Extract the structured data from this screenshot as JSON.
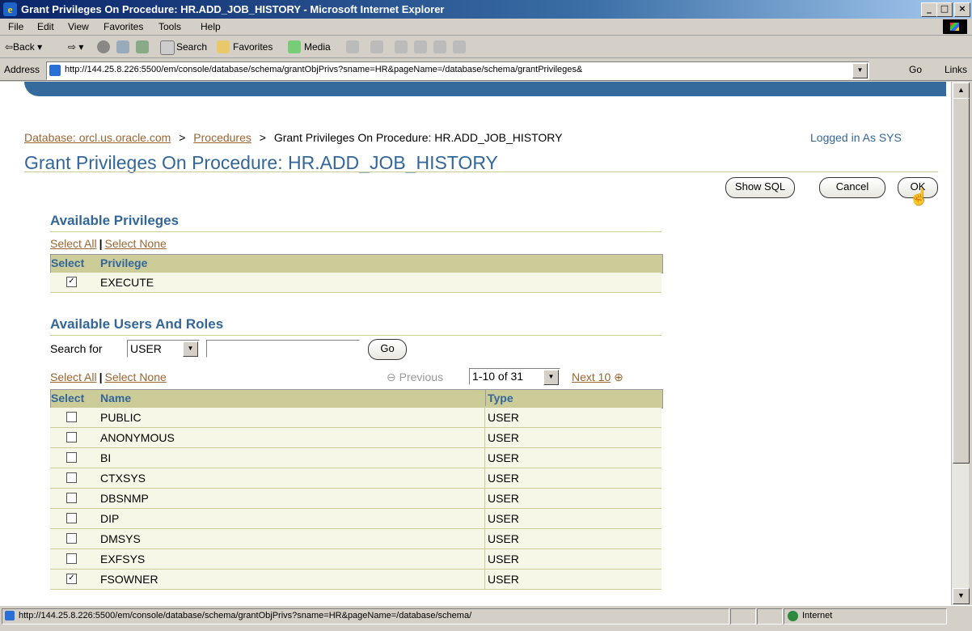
{
  "window": {
    "title": "Grant Privileges On Procedure: HR.ADD_JOB_HISTORY - Microsoft Internet Explorer",
    "min_label": "_",
    "max_label": "□",
    "close_label": "×"
  },
  "menu": [
    "File",
    "Edit",
    "View",
    "Favorites",
    "Tools",
    "Help"
  ],
  "toolbar": {
    "back": "⇦Back ▾",
    "forward": "⇨ ▾",
    "search": "Search",
    "favorites": "Favorites",
    "media": "Media"
  },
  "address": {
    "label": "Address",
    "url": "http://144.25.8.226:5500/em/console/database/schema/grantObjPrivs?sname=HR&pageName=/database/schema/grantPrivileges&",
    "go": "Go",
    "links": "Links"
  },
  "breadcrumb": {
    "database": "Database: orcl.us.oracle.com",
    "sep1": ">",
    "procedures": "Procedures",
    "sep2": ">",
    "current": "Grant Privileges On Procedure: HR.ADD_JOB_HISTORY"
  },
  "logged_in": "Logged in As SYS",
  "page_title": "Grant Privileges On Procedure: HR.ADD_JOB_HISTORY",
  "buttons": {
    "show_sql": "Show SQL",
    "cancel": "Cancel",
    "ok": "OK"
  },
  "privileges": {
    "title": "Available Privileges",
    "select_all": "Select All",
    "separator": "|",
    "select_none": "Select None",
    "col_select": "Select",
    "col_privilege": "Privilege",
    "rows": [
      {
        "name": "EXECUTE",
        "checked": true,
        "check_mark": "✓"
      }
    ]
  },
  "users": {
    "title": "Available Users And Roles",
    "search_label": "Search for",
    "search_type": "USER",
    "search_value": "",
    "go": "Go",
    "select_all": "Select All",
    "separator": "|",
    "select_none": "Select None",
    "previous": "Previous",
    "range": "1-10 of 31",
    "next": "Next 10",
    "col_select": "Select",
    "col_name": "Name",
    "col_type": "Type",
    "rows": [
      {
        "name": "PUBLIC",
        "type": "USER",
        "check_mark": ""
      },
      {
        "name": "ANONYMOUS",
        "type": "USER",
        "check_mark": ""
      },
      {
        "name": "BI",
        "type": "USER",
        "check_mark": ""
      },
      {
        "name": "CTXSYS",
        "type": "USER",
        "check_mark": ""
      },
      {
        "name": "DBSNMP",
        "type": "USER",
        "check_mark": ""
      },
      {
        "name": "DIP",
        "type": "USER",
        "check_mark": ""
      },
      {
        "name": "DMSYS",
        "type": "USER",
        "check_mark": ""
      },
      {
        "name": "EXFSYS",
        "type": "USER",
        "check_mark": ""
      },
      {
        "name": "FSOWNER",
        "type": "USER",
        "check_mark": "✓"
      }
    ]
  },
  "status": {
    "url": "http://144.25.8.226:5500/em/console/database/schema/grantObjPrivs?sname=HR&pageName=/database/schema/",
    "zone": "Internet"
  },
  "colors": {
    "link": "#996633",
    "heading": "#336699",
    "table_header": "#cccc99",
    "banner": "#356a9c"
  }
}
